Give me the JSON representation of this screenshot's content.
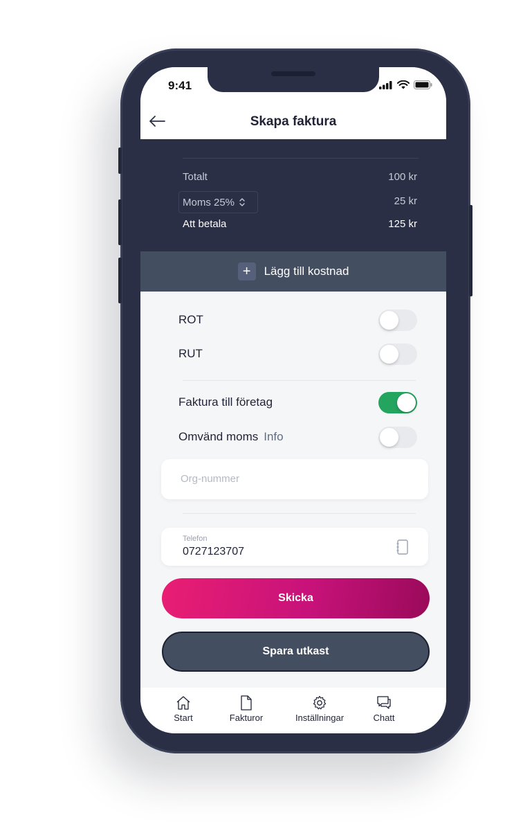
{
  "status": {
    "time": "9:41"
  },
  "nav": {
    "title": "Skapa faktura"
  },
  "summary": {
    "total_label": "Totalt",
    "total_value": "100 kr",
    "vat_label": "Moms 25%",
    "vat_value": "25 kr",
    "pay_label": "Att betala",
    "pay_value": "125 kr"
  },
  "add_cost_label": "Lägg till kostnad",
  "toggles": {
    "rot": {
      "label": "ROT",
      "on": false
    },
    "rut": {
      "label": "RUT",
      "on": false
    },
    "company": {
      "label": "Faktura till företag",
      "on": true
    },
    "reverse_vat": {
      "label": "Omvänd moms",
      "info": "Info",
      "on": false
    }
  },
  "fields": {
    "org_placeholder": "Org-nummer",
    "phone_label": "Telefon",
    "phone_value": "0727123707"
  },
  "buttons": {
    "send": "Skicka",
    "draft": "Spara utkast"
  },
  "tabs": [
    {
      "label": "Start",
      "icon": "home-icon"
    },
    {
      "label": "Fakturor",
      "icon": "document-icon"
    },
    {
      "label": "Inställningar",
      "icon": "gear-icon"
    },
    {
      "label": "Chatt",
      "icon": "chat-icon"
    }
  ],
  "colors": {
    "primary_dark": "#2b2f45",
    "toggle_on": "#23a45f",
    "send_gradient_start": "#e91e73",
    "send_gradient_end": "#9a0a5a"
  }
}
